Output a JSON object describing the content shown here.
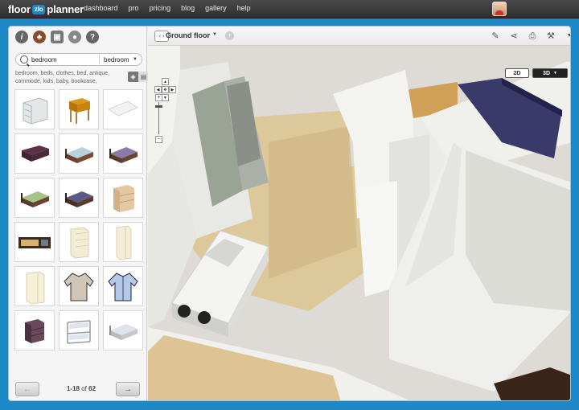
{
  "app": {
    "logo_left": "floor",
    "logo_badge": "zlo",
    "logo_right": "planner",
    "nav": [
      "dashboard",
      "pro",
      "pricing",
      "blog",
      "gallery",
      "help"
    ]
  },
  "library": {
    "search_value": "bedroom",
    "category": "bedroom",
    "tags": "bedroom, beds, clothes, bed, antique, commode, kids, baby, bookcase,",
    "items": [
      {
        "icon": "dresser-icon"
      },
      {
        "icon": "side-table-icon"
      },
      {
        "icon": "mat-icon"
      },
      {
        "icon": "dark-bed-icon"
      },
      {
        "icon": "blue-bed-icon"
      },
      {
        "icon": "purple-bed-icon"
      },
      {
        "icon": "green-bed-icon"
      },
      {
        "icon": "navy-bed-icon"
      },
      {
        "icon": "chest-of-drawers-icon"
      },
      {
        "icon": "long-cabinet-icon"
      },
      {
        "icon": "cream-cabinet-icon"
      },
      {
        "icon": "cream-wardrobe-icon"
      },
      {
        "icon": "white-wardrobe-icon"
      },
      {
        "icon": "sweater-icon"
      },
      {
        "icon": "shirt-icon"
      },
      {
        "icon": "nightstand-icon"
      },
      {
        "icon": "bunk-bed-icon"
      },
      {
        "icon": "single-bed-icon"
      }
    ],
    "pager": {
      "prev": "←",
      "next": "→",
      "range": "1-18",
      "of": "of",
      "total": "62"
    }
  },
  "editor": {
    "floor_name": "Ground floor",
    "view_2d": "2D",
    "view_3d": "3D"
  },
  "colors": {
    "accent": "#1e87c6",
    "topbar": "#3a3a3a"
  }
}
